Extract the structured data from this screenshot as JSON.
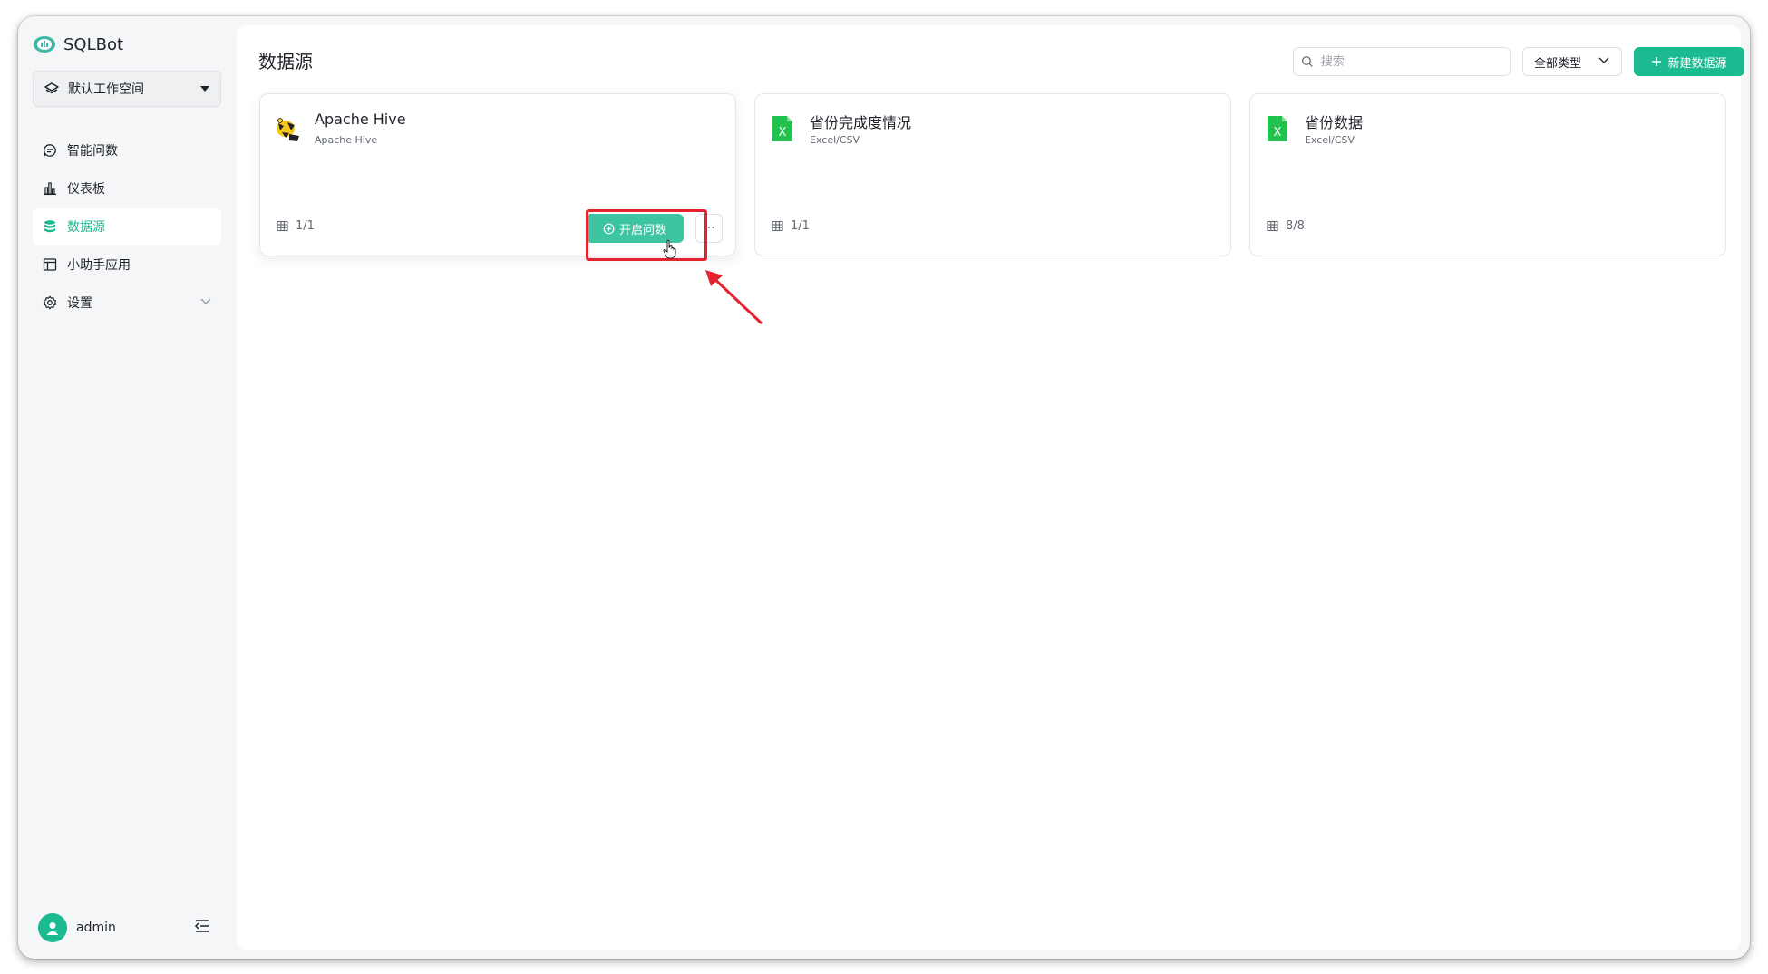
{
  "app": {
    "name": "SQLBot"
  },
  "workspace": {
    "label": "默认工作空间"
  },
  "sidebar": {
    "items": [
      {
        "label": "智能问数",
        "icon": "chat-icon",
        "active": false
      },
      {
        "label": "仪表板",
        "icon": "bar-chart-icon",
        "active": false
      },
      {
        "label": "数据源",
        "icon": "database-icon",
        "active": true
      },
      {
        "label": "小助手应用",
        "icon": "app-window-icon",
        "active": false
      },
      {
        "label": "设置",
        "icon": "gear-icon",
        "active": false,
        "expandable": true
      }
    ]
  },
  "user": {
    "name": "admin"
  },
  "page": {
    "title": "数据源"
  },
  "toolbar": {
    "search_placeholder": "搜索",
    "type_filter": "全部类型",
    "new_button": "新建数据源"
  },
  "cards": [
    {
      "name": "Apache Hive",
      "type": "Apache Hive",
      "count": "1/1",
      "icon": "hive-icon",
      "ask_label": "开启问数",
      "more_label": "···"
    },
    {
      "name": "省份完成度情况",
      "type": "Excel/CSV",
      "count": "1/1",
      "icon": "excel-icon"
    },
    {
      "name": "省份数据",
      "type": "Excel/CSV",
      "count": "8/8",
      "icon": "excel-icon"
    }
  ],
  "colors": {
    "accent": "#1cba90",
    "highlight": "#e5232f",
    "excel": "#22c24e"
  }
}
